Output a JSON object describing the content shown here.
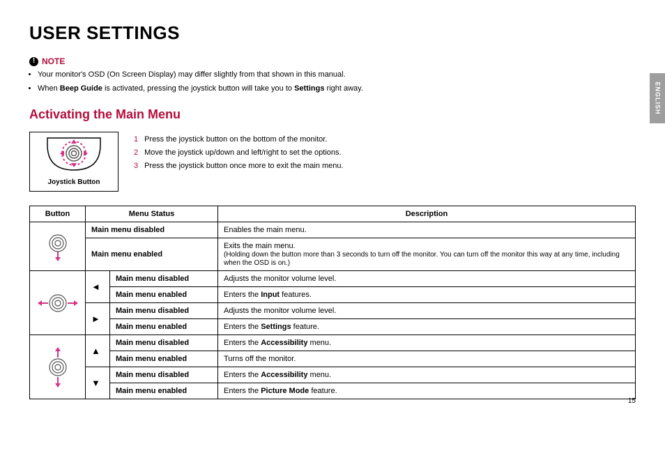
{
  "title": "USER SETTINGS",
  "lang_tab": "ENGLISH",
  "note": {
    "label": "NOTE",
    "items": [
      {
        "pre": "Your monitor's OSD (On Screen Display) may differ slightly from that shown in this manual."
      },
      {
        "pre": "When ",
        "b1": "Beep Guide",
        "mid": " is activated, pressing the joystick button will take you to ",
        "b2": "Settings",
        "post": " right away."
      }
    ]
  },
  "section": "Activating the Main Menu",
  "joystick_label": "Joystick Button",
  "steps": [
    "Press the joystick button on the bottom of the monitor.",
    "Move the joystick up/down and left/right to set the options.",
    "Press the joystick button once more to exit the main menu."
  ],
  "table": {
    "headers": {
      "button": "Button",
      "menu": "Menu Status",
      "desc": "Description"
    },
    "status": {
      "disabled": "Main menu disabled",
      "enabled": "Main menu enabled"
    },
    "rows": {
      "press_disabled": "Enables the main menu.",
      "press_enabled_l1": "Exits the main menu.",
      "press_enabled_l2": "(Holding down the button more than 3 seconds to turn off the monitor. You can turn off the monitor this way at any time, including when the OSD is on.)",
      "left_disabled": "Adjusts the monitor volume level.",
      "left_enabled_pre": "Enters the ",
      "left_enabled_b": "Input",
      "left_enabled_post": " features.",
      "right_disabled": "Adjusts the monitor volume level.",
      "right_enabled_pre": "Enters the ",
      "right_enabled_b": "Settings",
      "right_enabled_post": " feature.",
      "up_disabled_pre": "Enters the ",
      "up_disabled_b": "Accessibility",
      "up_disabled_post": " menu.",
      "up_enabled": "Turns off the monitor.",
      "down_disabled_pre": "Enters the ",
      "down_disabled_b": "Accessibility",
      "down_disabled_post": " menu.",
      "down_enabled_pre": "Enters the ",
      "down_enabled_b": "Picture Mode",
      "down_enabled_post": " feature."
    }
  },
  "page_number": "15"
}
